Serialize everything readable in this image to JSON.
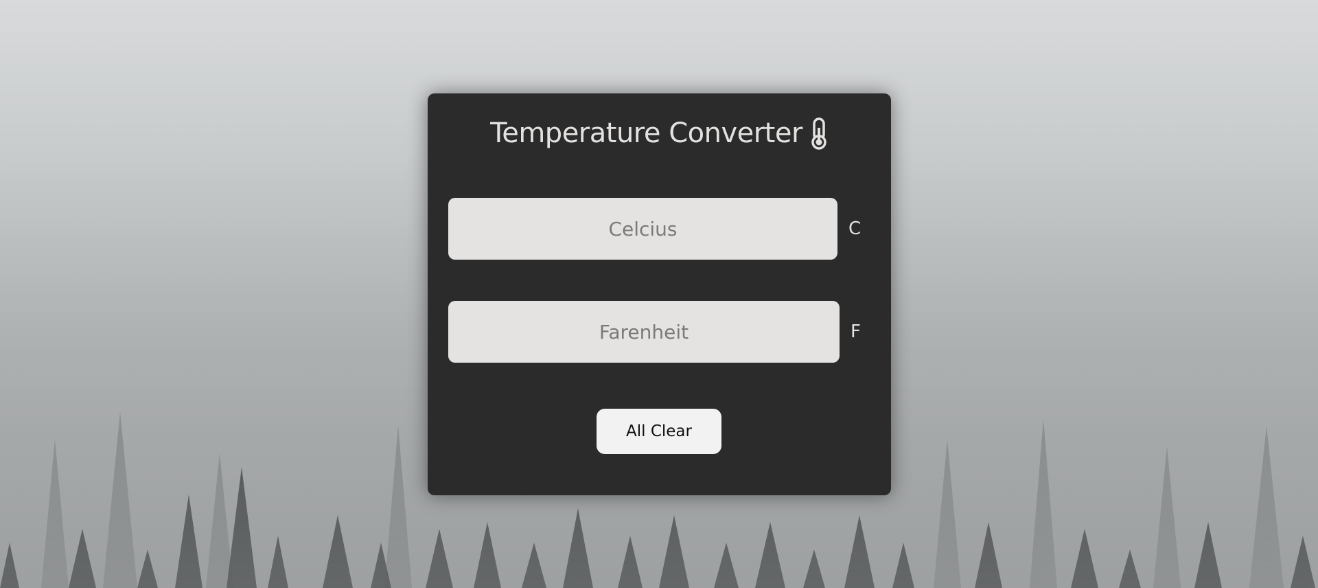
{
  "app": {
    "title": "Temperature Converter",
    "title_icon": "thermometer-icon"
  },
  "fields": {
    "celsius": {
      "value": "",
      "placeholder": "Celcius",
      "unit": "C"
    },
    "fahrenheit": {
      "value": "",
      "placeholder": "Farenheit",
      "unit": "F"
    }
  },
  "actions": {
    "clear_label": "All Clear"
  },
  "colors": {
    "card_bg": "#2b2b2b",
    "input_bg": "#e4e3e1",
    "button_bg": "#f2f2f2",
    "text_light": "#e4e2e0"
  }
}
